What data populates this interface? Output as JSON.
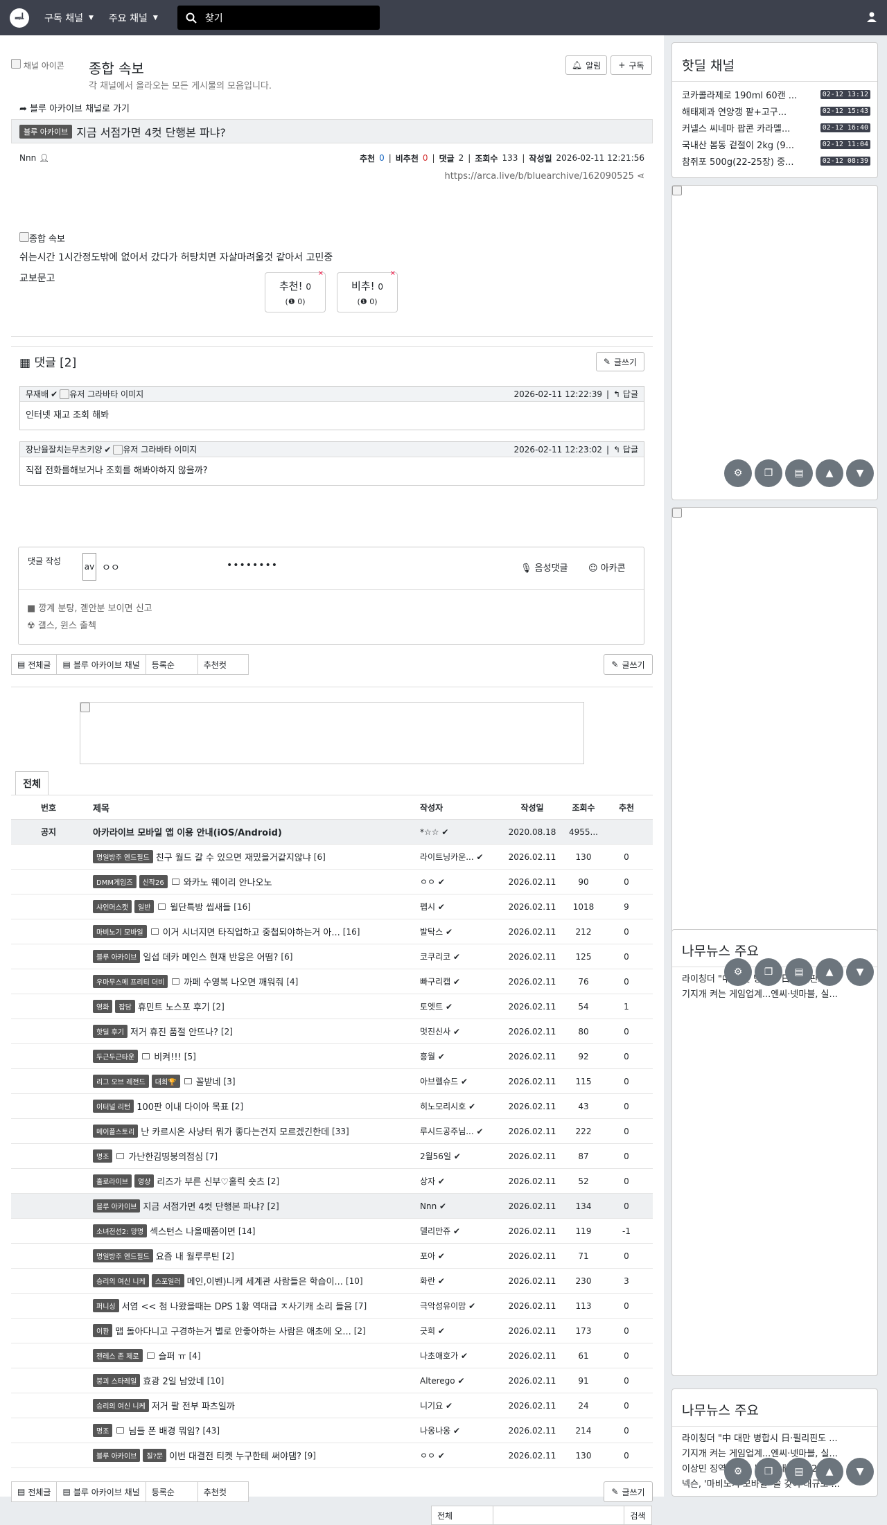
{
  "nav": {
    "menu1": "구독 채널",
    "menu2": "주요 채널",
    "search_placeholder": "찾기"
  },
  "channel": {
    "icon_alt": "채널 아이콘",
    "title": "종합 속보",
    "description": "각 채널에서 올라오는 모든 게시물의 모음입니다.",
    "alarm": "알림",
    "subscribe": "구독"
  },
  "post": {
    "back": "블루 아카이브 채널로 가기",
    "category": "블루 아카이브",
    "title": "지금 서점가면 4컷 단행본 파냐?",
    "author": "Nnn",
    "rec_label": "추천",
    "rec": "0",
    "unrec_label": "비추천",
    "unrec": "0",
    "cmt_label": "댓글",
    "cmt": "2",
    "views_label": "조회수",
    "views": "133",
    "date_label": "작성일",
    "date": "2026-02-11 12:21:56",
    "url": "https://arca.live/b/bluearchive/162090525",
    "img_alt": "종합 속보",
    "line1": "쉬는시간 1시간정도밖에 없어서 갔다가 허탕치면 자살마려울것 같아서 고민중",
    "line2": "교보문고",
    "vote_up": "추천!",
    "vote_up_n": "0",
    "vote_up_sub": "0",
    "vote_down": "비추!",
    "vote_down_n": "0",
    "vote_down_sub": "0"
  },
  "comments": {
    "heading": "댓글 [2]",
    "write": "글쓰기",
    "avatar_alt": "유저 그라바타 이미지",
    "reply": "답글",
    "items": [
      {
        "author": "무재배",
        "date": "2026-02-11 12:22:39",
        "text": "인터넷 재고 조회 해봐"
      },
      {
        "author": "장난율잘치는무츠키양",
        "date": "2026-02-11 12:23:02",
        "text": "직접 전화를해보거나 조회를 해봐야하지 않을까?"
      }
    ],
    "form_label": "댓글 작성",
    "nick": "ㅇㅇ",
    "password": "••••••••",
    "voice": "음성댓글",
    "arcacon": "아카콘",
    "avatar_text": "av",
    "rule1": "깡계 분탕, 곋안분 보이면 신고",
    "rule2": "갤스, 윈스 출첵"
  },
  "tabs": {
    "all": "전체글",
    "channel": "블루 아카이브 채널",
    "sort1": "등록순",
    "sort2": "추천컷",
    "write": "글쓰기"
  },
  "list": {
    "tab": "전체",
    "headers": {
      "no": "번호",
      "title": "제목",
      "author": "작성자",
      "date": "작성일",
      "views": "조회수",
      "rec": "추천"
    },
    "notice": {
      "no": "공지",
      "title": "아카라이브 모바일 앱 이용 안내(iOS/Android)",
      "author": "*☆☆",
      "date": "2020.08.18",
      "views": "4955...",
      "rec": ""
    },
    "rows": [
      {
        "b1": "명일방주 엔드필드",
        "b2": "",
        "img": false,
        "title": "친구 월드 갈 수 있으면 재밌을거같지않냐",
        "cnt": "[6]",
        "author": "라이트닝카운...",
        "date": "2026.02.11",
        "views": "130",
        "rec": "0"
      },
      {
        "b1": "DMM게임즈",
        "b2": "신작26",
        "img": true,
        "title": "와카노 웨이리 안나오노",
        "cnt": "",
        "author": "ㅇㅇ",
        "date": "2026.02.11",
        "views": "90",
        "rec": "0"
      },
      {
        "b1": "샤인머스캣",
        "b2": "일반",
        "img": true,
        "title": "윌단특방 씹새들",
        "cnt": "[16]",
        "author": "펩시",
        "date": "2026.02.11",
        "views": "1018",
        "rec": "9"
      },
      {
        "b1": "마비노기 모바일",
        "b2": "",
        "img": true,
        "title": "이거 시너지면 타직업하고 중첩되야하는거 아...",
        "cnt": "[16]",
        "author": "발탁스",
        "date": "2026.02.11",
        "views": "212",
        "rec": "0"
      },
      {
        "b1": "블루 아카이브",
        "b2": "",
        "img": false,
        "title": "일섭 데카 메인스 현재 반응은 어떰?",
        "cnt": "[6]",
        "author": "코쿠리코",
        "date": "2026.02.11",
        "views": "125",
        "rec": "0"
      },
      {
        "b1": "우마무스메 프리티 더비",
        "b2": "",
        "img": true,
        "title": "까페 수영복 나오면 깨워줘",
        "cnt": "[4]",
        "author": "빠구리캡",
        "date": "2026.02.11",
        "views": "76",
        "rec": "0"
      },
      {
        "b1": "영화",
        "b2": "잡담",
        "img": false,
        "title": "휴민트 노스포 후기",
        "cnt": "[2]",
        "author": "토엣트",
        "date": "2026.02.11",
        "views": "54",
        "rec": "1"
      },
      {
        "b1": "핫딜 후기",
        "b2": "",
        "img": false,
        "title": "저거 휴진 품절 안뜨나?",
        "cnt": "[2]",
        "author": "멋진신사",
        "date": "2026.02.11",
        "views": "80",
        "rec": "0"
      },
      {
        "b1": "두근두근타운",
        "b2": "",
        "img": true,
        "title": "비켜!!!",
        "cnt": "[5]",
        "author": "흥월",
        "date": "2026.02.11",
        "views": "92",
        "rec": "0"
      },
      {
        "b1": "리그 오브 레전드",
        "b2": "대회🏆",
        "img": true,
        "title": "꼴받네",
        "cnt": "[3]",
        "author": "아브렐슈드",
        "date": "2026.02.11",
        "views": "115",
        "rec": "0"
      },
      {
        "b1": "이터널 리턴",
        "b2": "",
        "img": false,
        "title": "100판 이내 다이아 목표",
        "cnt": "[2]",
        "author": "히노모리시호",
        "date": "2026.02.11",
        "views": "43",
        "rec": "0"
      },
      {
        "b1": "메이플스토리",
        "b2": "",
        "img": false,
        "title": "난 카르시온 사냥터 뭐가 좋다는건지 모르겠긴한데",
        "cnt": "[33]",
        "author": "루시드공주님...",
        "date": "2026.02.11",
        "views": "222",
        "rec": "0"
      },
      {
        "b1": "명조",
        "b2": "",
        "img": true,
        "title": "가난한김띵붕의점심",
        "cnt": "[7]",
        "author": "2월56일",
        "date": "2026.02.11",
        "views": "87",
        "rec": "0"
      },
      {
        "b1": "홀로라이브",
        "b2": "영상",
        "img": false,
        "title": "리즈가 부른 신부♡홀릭 숏츠",
        "cnt": "[2]",
        "author": "상자",
        "date": "2026.02.11",
        "views": "52",
        "rec": "0"
      },
      {
        "b1": "블루 아카이브",
        "b2": "",
        "img": false,
        "title": "지금 서점가면 4컷 단행본 파냐?",
        "cnt": "[2]",
        "author": "Nnn",
        "date": "2026.02.11",
        "views": "134",
        "rec": "0",
        "current": true
      },
      {
        "b1": "소녀전선2: 망명",
        "b2": "",
        "img": false,
        "title": "섹스턴스 나올때쯤이면",
        "cnt": "[14]",
        "author": "델리만쥬",
        "date": "2026.02.11",
        "views": "119",
        "rec": "-1"
      },
      {
        "b1": "명일방주 엔드필드",
        "b2": "",
        "img": false,
        "title": "요즘 내 월루루틴",
        "cnt": "[2]",
        "author": "포아",
        "date": "2026.02.11",
        "views": "71",
        "rec": "0"
      },
      {
        "b1": "승리의 여신 니케",
        "b2": "스포일러",
        "img": false,
        "title": "메인,이벤)니케 세계관 사람들은 학습이...",
        "cnt": "[10]",
        "author": "화란",
        "date": "2026.02.11",
        "views": "230",
        "rec": "3"
      },
      {
        "b1": "퍼니싱",
        "b2": "",
        "img": false,
        "title": "서염 << 첨 나왔을때는 DPS 1황 역대급 ㅈ사기캐 소리 들음",
        "cnt": "[7]",
        "author": "극악성유이맘",
        "date": "2026.02.11",
        "views": "113",
        "rec": "0"
      },
      {
        "b1": "이환",
        "b2": "",
        "img": false,
        "title": "맵 돌아다니고 구경하는거 별로 안좋아하는 사람은 애초에 오...",
        "cnt": "[2]",
        "author": "긋희",
        "date": "2026.02.11",
        "views": "173",
        "rec": "0"
      },
      {
        "b1": "젠레스 존 제로",
        "b2": "",
        "img": true,
        "title": "슬퍼 ㅠ",
        "cnt": "[4]",
        "author": "나초애호가",
        "date": "2026.02.11",
        "views": "61",
        "rec": "0"
      },
      {
        "b1": "붕괴 스타레일",
        "b2": "",
        "img": false,
        "title": "효광 2일 남았네",
        "cnt": "[10]",
        "author": "Alterego",
        "date": "2026.02.11",
        "views": "91",
        "rec": "0"
      },
      {
        "b1": "승리의 여신 니케",
        "b2": "",
        "img": false,
        "title": "저거 팔 전부 파츠일까",
        "cnt": "",
        "author": "니기요",
        "date": "2026.02.11",
        "views": "24",
        "rec": "0"
      },
      {
        "b1": "명조",
        "b2": "",
        "img": true,
        "title": "님들 폰 배경 뭐임?",
        "cnt": "[43]",
        "author": "나옹나옹",
        "date": "2026.02.11",
        "views": "214",
        "rec": "0"
      },
      {
        "b1": "블루 아카이브",
        "b2": "질?문",
        "img": false,
        "title": "이번 대결전 티켓 누구한테 써야댐?",
        "cnt": "[9]",
        "author": "ㅇㅇ",
        "date": "2026.02.11",
        "views": "130",
        "rec": "0"
      }
    ]
  },
  "search_form": {
    "scope": "전체",
    "button": "검색"
  },
  "sidebar": {
    "hot_title": "핫딜 채널",
    "hot": [
      {
        "t": "코카콜라제로 190ml 60캔 ...",
        "d": "02-12 13:12"
      },
      {
        "t": "해태제과 연양갱 팥+고구...",
        "d": "02-12 15:43"
      },
      {
        "t": "커넬스 씨네마 팝콘 카라멜...",
        "d": "02-12 16:40"
      },
      {
        "t": "국내산 봄동 겉절이 2kg (9...",
        "d": "02-12 11:04"
      },
      {
        "t": "참쥐포 500g(22-25장) 중...",
        "d": "02-12 08:39"
      }
    ],
    "news_title": "나무뉴스 주요",
    "news1": [
      "라이칭더 \"中 대만 병합시 日·필리핀도 ...",
      "기지개 켜는 게임업계...엔씨·넷마블, 실..."
    ],
    "news2": [
      "라이칭더 \"中 대만 병합시 日·필리핀도 ...",
      "기지개 켜는 게임업계...엔씨·넷마블, 실...",
      "이상민 징역 7년... 법원 \"내란은 12·3 ...",
      "넥슨, '마비노기 모바일' 쓸 갖이 대규모 ..."
    ]
  }
}
